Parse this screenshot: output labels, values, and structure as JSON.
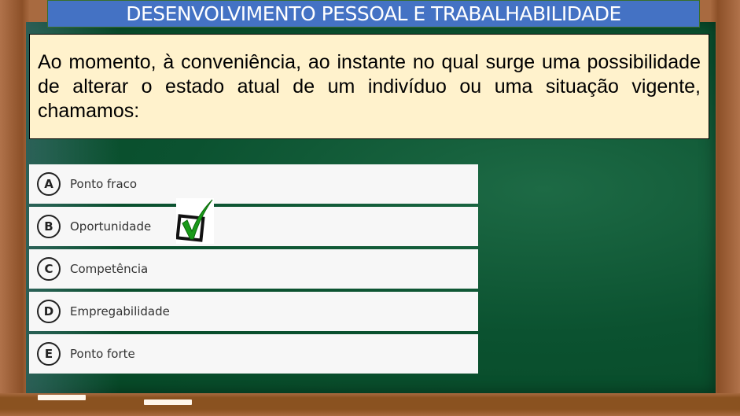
{
  "title": "DESENVOLVIMENTO PESSOAL E TRABALHABILIDADE",
  "question": "Ao momento, à conveniência, ao instante no qual surge uma possibilidade de alterar o estado atual de um indivíduo ou uma situação vigente, chamamos:",
  "options": [
    {
      "letter": "A",
      "label": "Ponto fraco"
    },
    {
      "letter": "B",
      "label": "Oportunidade"
    },
    {
      "letter": "C",
      "label": "Competência"
    },
    {
      "letter": "D",
      "label": "Empregabilidade"
    },
    {
      "letter": "E",
      "label": "Ponto forte"
    }
  ],
  "correct_option": "B",
  "colors": {
    "title_bg": "#4472c4",
    "question_bg": "#fff2cc",
    "board": "#0b5230",
    "check": "#1a9a1a"
  }
}
